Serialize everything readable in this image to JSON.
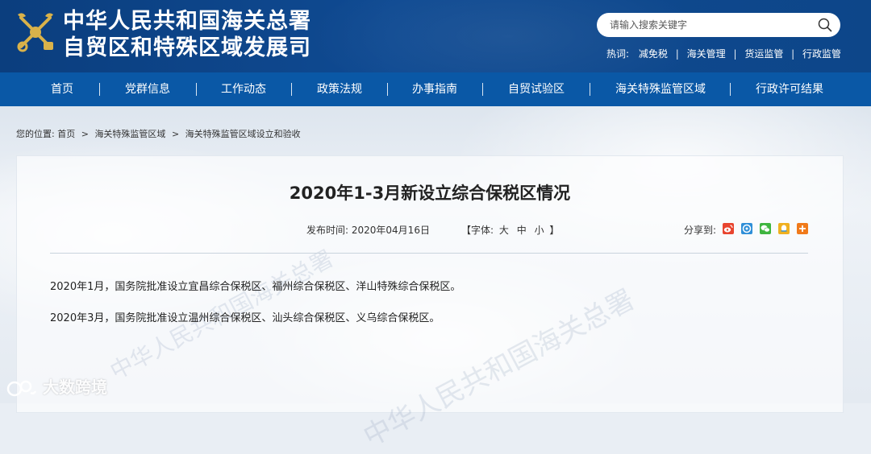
{
  "header": {
    "title_line1": "中华人民共和国海关总署",
    "title_line2": "自贸区和特殊区域发展司"
  },
  "search": {
    "placeholder": "请输入搜索关键字"
  },
  "hotwords": {
    "label": "热词:",
    "items": [
      "减免税",
      "海关管理",
      "货运监管",
      "行政监管"
    ]
  },
  "nav": {
    "items": [
      "首页",
      "党群信息",
      "工作动态",
      "政策法规",
      "办事指南",
      "自贸试验区",
      "海关特殊监管区域",
      "行政许可结果"
    ]
  },
  "breadcrumb": {
    "prefix": "您的位置:",
    "items": [
      "首页",
      "海关特殊监管区域",
      "海关特殊监管区域设立和验收"
    ],
    "separator": ">"
  },
  "article": {
    "title": "2020年1-3月新设立综合保税区情况",
    "publish_label": "发布时间:",
    "publish_date": "2020年04月16日",
    "font_label_open": "【字体:",
    "font_large": "大",
    "font_medium": "中",
    "font_small": "小",
    "font_label_close": "】",
    "share_label": "分享到:",
    "paragraphs": [
      "2020年1月，国务院批准设立宜昌综合保税区、福州综合保税区、洋山特殊综合保税区。",
      "2020年3月，国务院批准设立温州综合保税区、汕头综合保税区、义乌综合保税区。"
    ]
  },
  "share_icons": [
    {
      "name": "weibo-icon",
      "color": "#e8452f"
    },
    {
      "name": "qzone-icon",
      "color": "#2f8fd8"
    },
    {
      "name": "wechat-icon",
      "color": "#3fb53f"
    },
    {
      "name": "qq-icon",
      "color": "#f0b020"
    },
    {
      "name": "more-icon",
      "color": "#f07a1a"
    }
  ],
  "watermark": {
    "text": "大数跨境"
  },
  "colors": {
    "header_bg": "#0f4a92",
    "nav_bg": "#0a58a6",
    "accent_gold": "#d9b24a"
  }
}
